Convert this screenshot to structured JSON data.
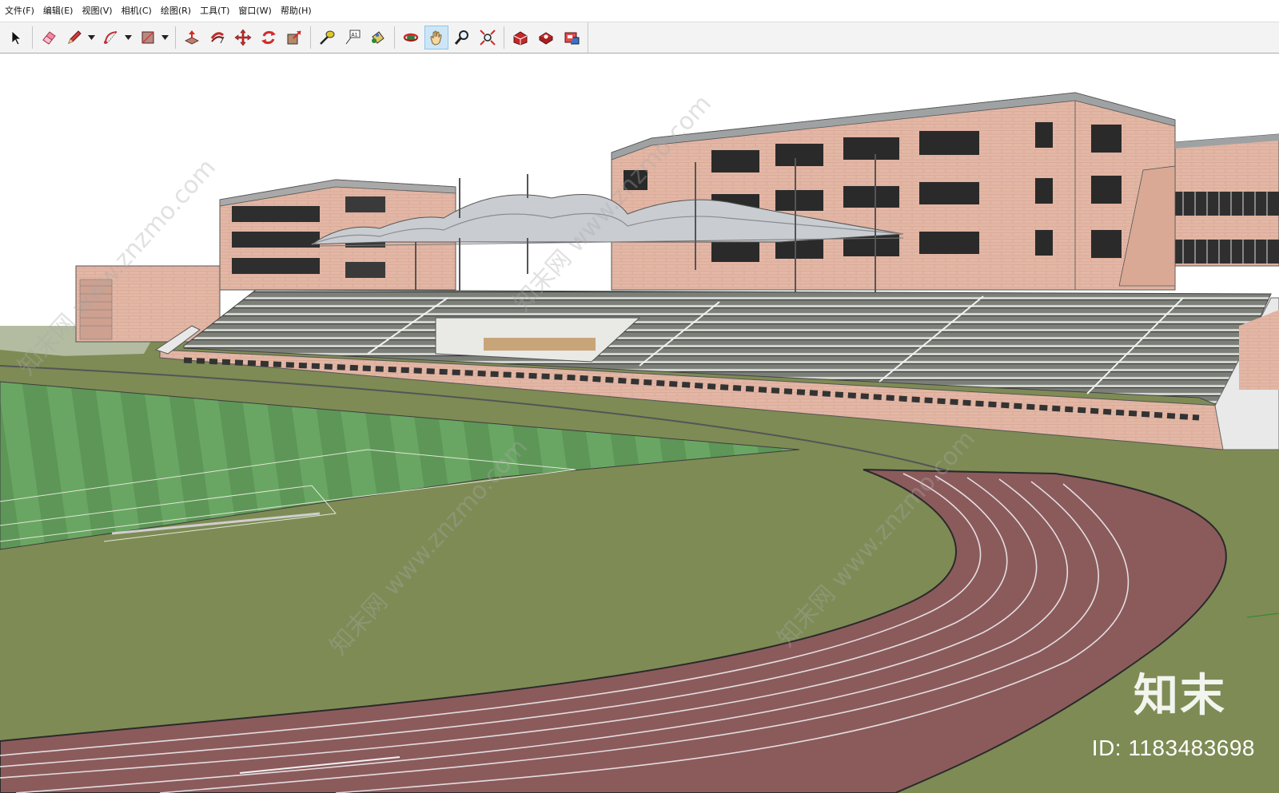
{
  "menubar": {
    "items": [
      {
        "label": "文件(F)"
      },
      {
        "label": "编辑(E)"
      },
      {
        "label": "视图(V)"
      },
      {
        "label": "相机(C)"
      },
      {
        "label": "绘图(R)"
      },
      {
        "label": "工具(T)"
      },
      {
        "label": "窗口(W)"
      },
      {
        "label": "帮助(H)"
      }
    ]
  },
  "toolbar": {
    "tools": [
      {
        "icon": "select-arrow-icon"
      },
      {
        "icon": "eraser-icon"
      },
      {
        "icon": "pencil-icon"
      },
      {
        "icon": "arc-icon"
      },
      {
        "icon": "rectangle-icon"
      },
      {
        "icon": "push-pull-icon"
      },
      {
        "icon": "follow-me-icon"
      },
      {
        "icon": "move-icon"
      },
      {
        "icon": "rotate-icon"
      },
      {
        "icon": "scale-icon"
      },
      {
        "icon": "tape-measure-icon"
      },
      {
        "icon": "text-label-icon",
        "text": "A1"
      },
      {
        "icon": "paint-bucket-icon"
      },
      {
        "icon": "orbit-icon"
      },
      {
        "icon": "pan-hand-icon",
        "active": true
      },
      {
        "icon": "zoom-icon"
      },
      {
        "icon": "zoom-extents-icon"
      },
      {
        "icon": "warehouse-get-models-icon"
      },
      {
        "icon": "share-model-icon"
      },
      {
        "icon": "extension-warehouse-icon"
      }
    ]
  },
  "viewport": {
    "watermark": "知末网 www.znzmo.com",
    "brand_logo": "知末",
    "brand_id": "ID: 1183483698"
  },
  "colors": {
    "track": "#8a5a5c",
    "grass": "#7a8a52",
    "field": "#5f9a5a",
    "building": "#e3b7a5",
    "roof": "#b8bcc0"
  }
}
